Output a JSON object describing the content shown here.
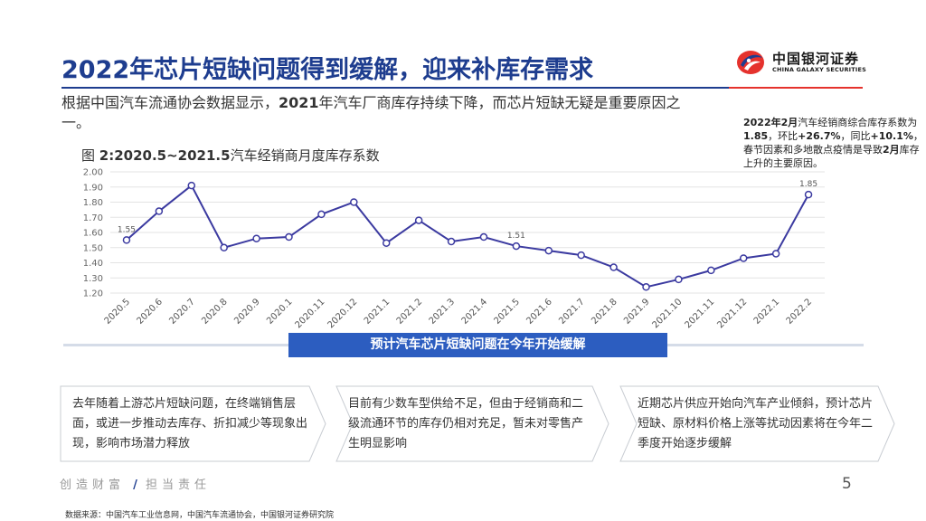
{
  "header": {
    "title": "2022年芯片短缺问题得到缓解，迎来补库存需求",
    "logo_cn": "中国银河证券",
    "logo_en": "CHINA GALAXY SECURITIES"
  },
  "intro": {
    "part1": "根据中国汽车流通协会数据显示，",
    "year": "2021",
    "part2": "年汽车厂商库存持续下降，而芯片短缺无疑是重要原因之一。"
  },
  "note": {
    "a": "2022年2月",
    "b": "汽车经销商综合库存系数为",
    "c": "1.85",
    "d": "，环比",
    "e": "+26.7%",
    "f": "，同比",
    "g": "+10.1%",
    "h": "，春节因素和多地散点疫情是导致",
    "i": "2月",
    "j": "库存上升的主要原因。"
  },
  "figure": {
    "prefix": "图 ",
    "range": "2:2020.5~2021.5",
    "suffix": "汽车经销商月度库存系数"
  },
  "chart_data": {
    "type": "line",
    "categories": [
      "2020.5",
      "2020.6",
      "2020.7",
      "2020.8",
      "2020.9",
      "2020.1",
      "2020.11",
      "2020.12",
      "2021.1",
      "2021.2",
      "2021.3",
      "2021.4",
      "2021.5",
      "2021.6",
      "2021.7",
      "2021.8",
      "2021.9",
      "2021.10",
      "2021.11",
      "2021.12",
      "2022.1",
      "2022.2"
    ],
    "values": [
      1.55,
      1.74,
      1.91,
      1.5,
      1.56,
      1.57,
      1.72,
      1.8,
      1.53,
      1.68,
      1.54,
      1.57,
      1.51,
      1.48,
      1.45,
      1.37,
      1.24,
      1.29,
      1.35,
      1.43,
      1.46,
      1.85
    ],
    "data_labels": [
      {
        "index": 0,
        "text": "1.55"
      },
      {
        "index": 12,
        "text": "1.51"
      },
      {
        "index": 21,
        "text": "1.85"
      }
    ],
    "yticks": [
      "1.20",
      "1.30",
      "1.40",
      "1.50",
      "1.60",
      "1.70",
      "1.80",
      "1.90",
      "2.00"
    ],
    "ylim": [
      1.2,
      2.0
    ],
    "grid": true,
    "line_color": "#3b3aa0",
    "marker_fill": "#ffffff"
  },
  "banner": "预计汽车芯片短缺问题在今年开始缓解",
  "cards": [
    "去年随着上游芯片短缺问题，在终端销售层面，或进一步推动去库存、折扣减少等现象出现，影响市场潜力释放",
    "目前有少数车型供给不足，但由于经销商和二级流通环节的库存仍相对充足，暂未对零售产生明显影响",
    "近期芯片供应开始向汽车产业倾斜，预计芯片短缺、原材料价格上涨等扰动因素将在今年二季度开始逐步缓解"
  ],
  "footer": {
    "slogan_a": "创造财富",
    "slash": "/",
    "slogan_b": "担当责任",
    "page": "5",
    "source": "数据来源：中国汽车工业信息网，中国汽车流通协会，中国银河证券研究院"
  },
  "colors": {
    "title": "#1e3d8f",
    "accent_red": "#e5322d",
    "banner": "#2c5dc0"
  }
}
